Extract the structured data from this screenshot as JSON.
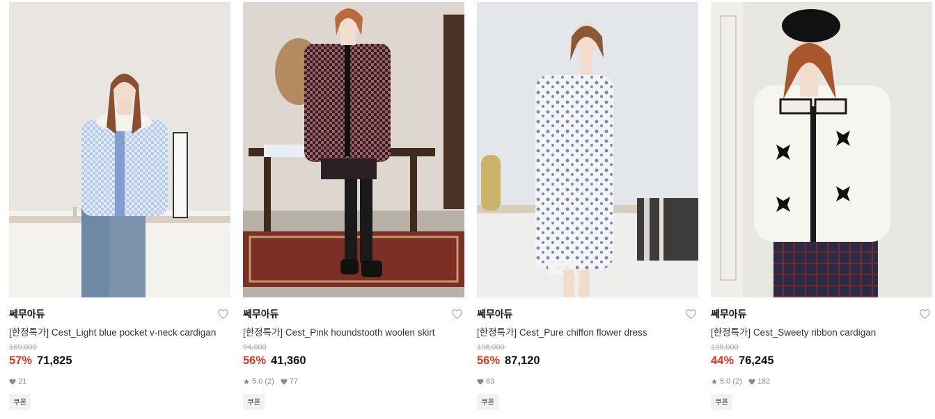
{
  "products": [
    {
      "brand": "쎄무아듀",
      "title": "[한정특가] Cest_Light blue pocket v-neck cardigan",
      "original_price": "169,000",
      "discount": "57%",
      "price": "71,825",
      "rating": "",
      "likes": "21",
      "coupon": "쿠폰"
    },
    {
      "brand": "쎄무아듀",
      "title": "[한정특가] Cest_Pink houndstooth woolen skirt",
      "original_price": "94,000",
      "discount": "56%",
      "price": "41,360",
      "rating": "5.0 (2)",
      "likes": "77",
      "coupon": "쿠폰"
    },
    {
      "brand": "쎄무아듀",
      "title": "[한정특가] Cest_Pure chiffon flower dress",
      "original_price": "198,000",
      "discount": "56%",
      "price": "87,120",
      "rating": "",
      "likes": "83",
      "coupon": "쿠폰"
    },
    {
      "brand": "쎄무아듀",
      "title": "[한정특가] Cest_Sweety ribbon cardigan",
      "original_price": "138,000",
      "discount": "44%",
      "price": "76,245",
      "rating": "5.0 (2)",
      "likes": "182",
      "coupon": "쿠폰"
    }
  ],
  "icons": {
    "wishlist": "heart-outline-icon",
    "likes": "heart-filled-icon",
    "rating": "star-icon"
  },
  "colors": {
    "discount": "#e4361c",
    "meta": "#8a8a8a",
    "coupon_bg": "#f2f2f2"
  }
}
